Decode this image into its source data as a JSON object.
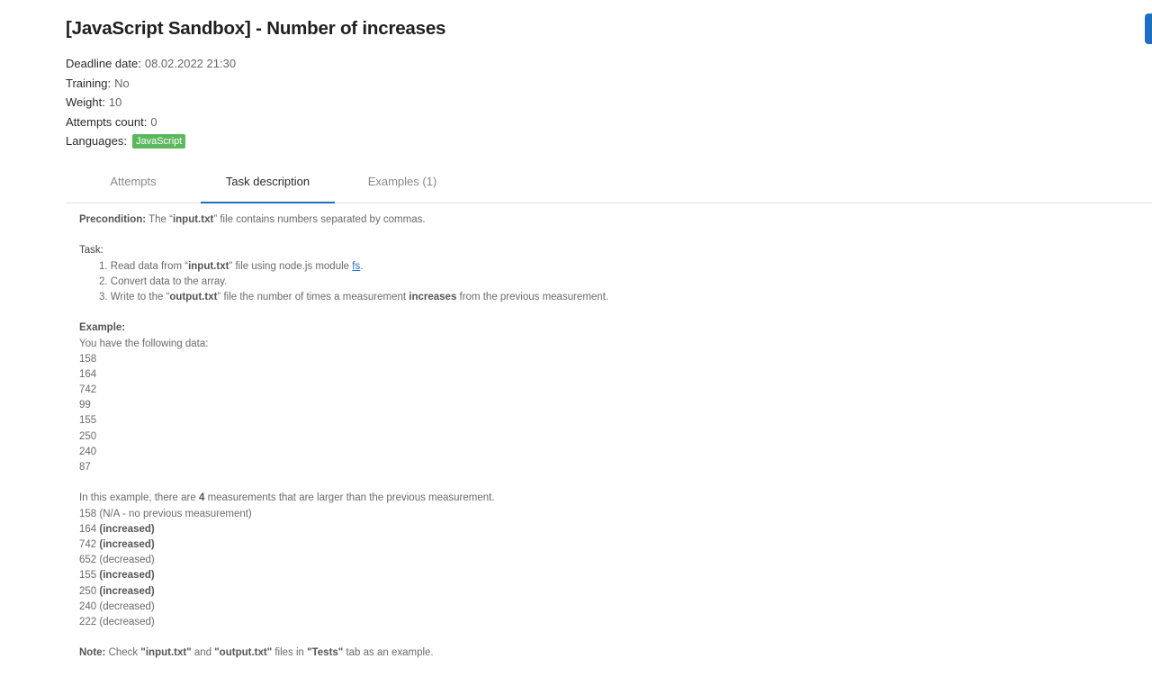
{
  "title": "[JavaScript Sandbox] - Number of increases",
  "meta": {
    "deadline_label": "Deadline date:",
    "deadline_value": "08.02.2022 21:30",
    "training_label": "Training:",
    "training_value": "No",
    "weight_label": "Weight:",
    "weight_value": "10",
    "attempts_label": "Attempts count:",
    "attempts_value": "0",
    "languages_label": "Languages:",
    "language_badge": "JavaScript"
  },
  "tabs": [
    {
      "label": "Attempts",
      "active": false
    },
    {
      "label": "Task description",
      "active": true
    },
    {
      "label": "Examples (1)",
      "active": false
    }
  ],
  "description": {
    "precondition_label": "Precondition:",
    "precondition_pre": " The “",
    "precondition_file": "input.txt",
    "precondition_post": "” file contains numbers separated by commas.",
    "task_label": "Task:",
    "steps": {
      "s1_pre": "1. Read data from “",
      "s1_file": "input.txt",
      "s1_mid": "” file using node.js module ",
      "s1_link": "fs",
      "s1_post": ".",
      "s2": "2. Convert data to the array.",
      "s3_pre": "3. Write to the “",
      "s3_file": "output.txt",
      "s3_mid": "” file the number of times a measurement ",
      "s3_bold": "increases",
      "s3_post": " from the previous measurement."
    },
    "example_label": "Example:",
    "example_intro": "You have the following data:",
    "data_values": [
      "158",
      "164",
      "742",
      "99",
      "155",
      "250",
      "240",
      "87"
    ],
    "explanation_pre": "In this example, there are ",
    "explanation_count": "4",
    "explanation_post": " measurements that are larger than the previous measurement.",
    "measurements": [
      {
        "value": "158",
        "note": "(N/A - no previous measurement)",
        "bold": false
      },
      {
        "value": "164",
        "note": "(increased)",
        "bold": true
      },
      {
        "value": "742",
        "note": "(increased)",
        "bold": true
      },
      {
        "value": "652",
        "note": "(decreased)",
        "bold": false
      },
      {
        "value": "155",
        "note": "(increased)",
        "bold": true
      },
      {
        "value": "250",
        "note": "(increased)",
        "bold": true
      },
      {
        "value": "240",
        "note": "(decreased)",
        "bold": false
      },
      {
        "value": "222",
        "note": "(decreased)",
        "bold": false
      }
    ],
    "note_label": "Note:",
    "note_pre": " Check ",
    "note_input": "\"input.txt\"",
    "note_and": " and ",
    "note_output": "\"output.txt\"",
    "note_mid": " files in ",
    "note_tests": "\"Tests\"",
    "note_post": " tab as an example."
  }
}
